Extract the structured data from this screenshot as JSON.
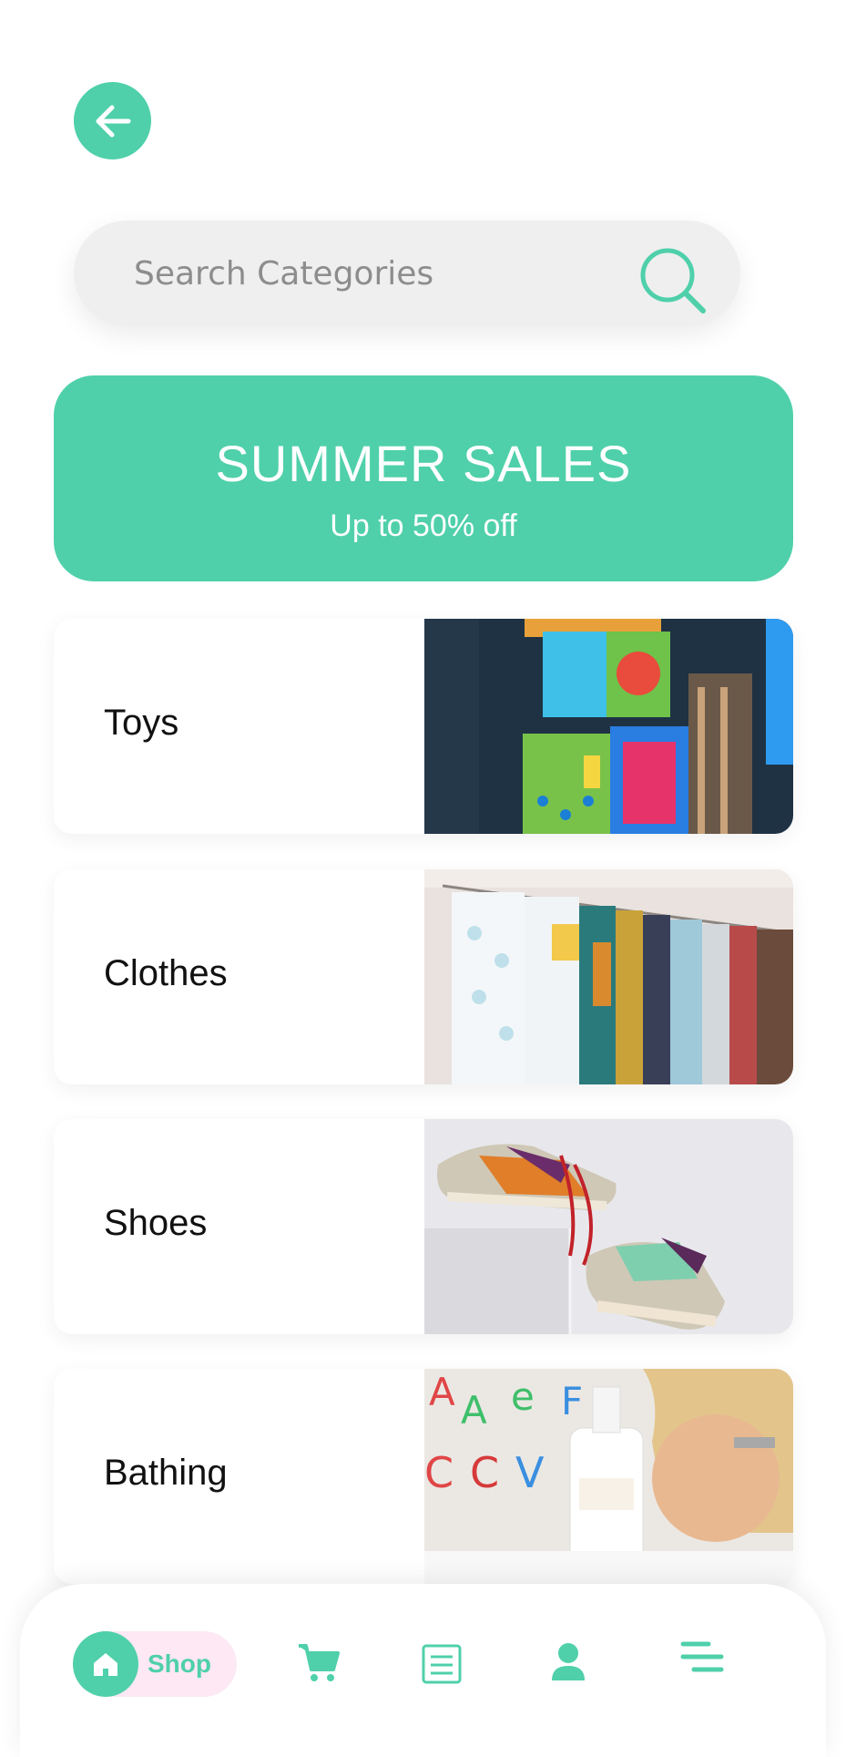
{
  "search": {
    "placeholder": "Search Categories"
  },
  "banner": {
    "title": "SUMMER SALES",
    "subtitle": "Up to 50% off"
  },
  "categories": [
    {
      "label": "Toys",
      "image": "toy-blocks-photo"
    },
    {
      "label": "Clothes",
      "image": "clothes-rack-photo"
    },
    {
      "label": "Shoes",
      "image": "sneakers-photo"
    },
    {
      "label": "Bathing",
      "image": "bath-child-photo"
    }
  ],
  "nav": {
    "shop_label": "Shop",
    "icons": [
      "home-icon",
      "cart-icon",
      "list-icon",
      "profile-icon",
      "menu-icon"
    ]
  },
  "colors": {
    "accent": "#4fd0aa",
    "pill": "#fde8f3",
    "search_bg": "#efefef"
  }
}
